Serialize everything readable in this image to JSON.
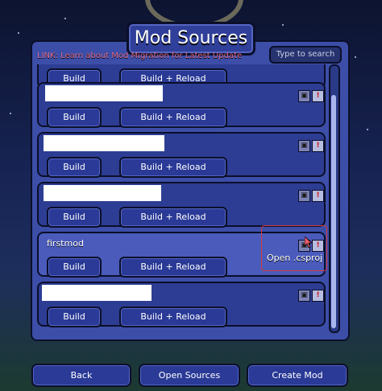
{
  "title": "Mod Sources",
  "link_text": "LINK: Learn about Mod Migration for Latest Update",
  "search_placeholder": "Type to search",
  "build_label": "Build",
  "build_reload_label": "Build + Reload",
  "tooltip": "Open .csproj",
  "rows": [
    {
      "name": ""
    },
    {
      "name": ""
    },
    {
      "name": ""
    },
    {
      "name": ""
    },
    {
      "name": "firstmod"
    },
    {
      "name": ""
    }
  ],
  "icons": {
    "csproj": "folder-icon",
    "warning": "exclamation-icon"
  },
  "bottom_buttons": {
    "back": "Back",
    "open_sources": "Open Sources",
    "create_mod": "Create Mod"
  },
  "colors": {
    "panel": "#3c4ea8",
    "row": "#2d3d93",
    "row_hover": "#4a5bbb",
    "link": "#e06a86",
    "highlight": "#d43a3a"
  }
}
